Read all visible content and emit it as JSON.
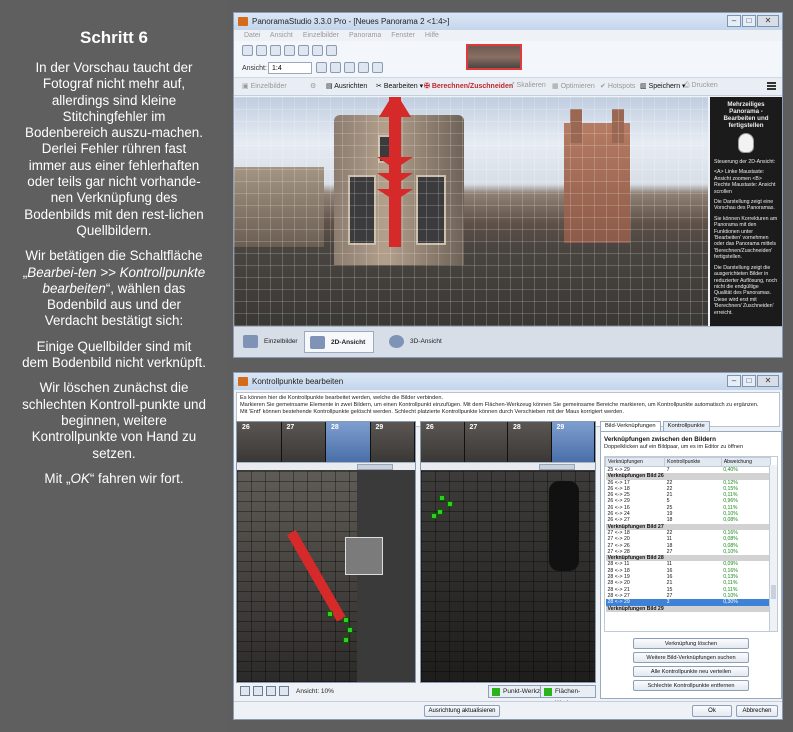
{
  "left": {
    "heading": "Schritt 6",
    "p1": "In der Vorschau taucht der Fotograf nicht mehr auf, allerdings sind kleine Stitchingfehler im Bodenbereich auszu-machen. Derlei Fehler rühren fast immer aus einer fehlerhaften oder teils gar nicht vorhande-nen Verknüpfung des Bodenbilds mit den rest-lichen Quellbildern.",
    "p2_a": "Wir betätigen die Schaltfläche „",
    "p2_em": "Bearbei-ten >> Kontrollpunkte bearbeiten",
    "p2_b": "“, wählen das Bodenbild aus und der Verdacht bestätigt sich:",
    "p3": "Einige Quellbilder sind mit dem Bodenbild nicht verknüpft.",
    "p4": "Wir löschen zunächst die schlechten Kontroll-punkte und beginnen, weitere Kontrollpunkte von Hand zu setzen.",
    "p5_a": "Mit „",
    "p5_em": "OK",
    "p5_b": "“ fahren wir fort."
  },
  "win1": {
    "title": "PanoramaStudio 3.3.0 Pro - [Neues Panorama 2 <1:4>]",
    "menu": [
      "Datei",
      "Ansicht",
      "Einzelbilder",
      "Panorama",
      "Fenster",
      "Hilfe"
    ],
    "ansicht_label": "Ansicht:",
    "ansicht_value": "1:4",
    "toolbar": {
      "einzelbilder": "Einzelbilder",
      "ausrichten": "Ausrichten",
      "bearbeiten": "Bearbeiten",
      "berechnen": "Berechnen/Zuschneiden",
      "skalieren": "Skalieren",
      "optimieren": "Optimieren",
      "hotspots": "Hotspots",
      "speichern": "Speichern",
      "drucken": "Drucken"
    },
    "side": {
      "title": "Mehrzeiliges Panorama - Bearbeiten und fertigstellen",
      "t1": "Steuerung der 2D-Ansicht:",
      "t2": "<A> Linke Maustaste: Ansicht zoomen <B> Rechte Maustaste: Ansicht scrollen",
      "t3": "Die Darstellung zeigt eine Vorschau des Panoramas.",
      "t4": "Sie können Korrekturen am Panorama mit den Funktionen unter 'Bearbeiten' vornehmen oder das Panorama mittels 'Berechnen/Zuschneiden' fertigstellen.",
      "t5": "Die Darstellung zeigt die ausgerichteten Bilder in reduzierter Auflösung, noch nicht die endgültige Qualität des Panoramas. Diese wird erst mit 'Berechnen/ Zuschneiden' erreicht."
    },
    "tabs": {
      "einzelbilder": "Einzelbilder",
      "ansicht2d": "2D-Ansicht",
      "ansicht3d": "3D-Ansicht"
    }
  },
  "win2": {
    "title": "Kontrollpunkte bearbeiten",
    "info1": "Es können hier die Kontrollpunkte bearbeitet werden, welche die Bilder verbinden.",
    "info2": "Markieren Sie gemeinsame Elemente in zwei Bildern, um einen Kontrollpunkt einzufügen. Mit dem Flächen-Werkzeug können Sie gemeinsame Bereiche markieren, um Kontrollpunkte automatisch zu ergänzen.",
    "info3": "Mit 'Entf' können bestehende Kontrollpunkte gelöscht werden. Schlecht platzierte Kontrollpunkte können durch Verschieben mit der Maus korrigiert werden.",
    "left_strip": [
      "26",
      "27",
      "28",
      "29"
    ],
    "right_strip": [
      "26",
      "27",
      "28",
      "29"
    ],
    "zoom_label": "Ansicht: 10%",
    "punkt_werkzeug": "Punkt-Werkzeug",
    "flaechen_werkzeug": "Flächen-Werkzeug",
    "tab_bild": "Bild-Verknüpfungen",
    "tab_kp": "Kontrollpunkte",
    "panel_title": "Verknüpfungen zwischen den Bildern",
    "panel_sub": "Doppelklicken auf ein Bildpaar, um es im Editor zu öffnen",
    "cols": [
      "Verknüpfungen",
      "Kontrollpunkte",
      "Abweichung"
    ],
    "rows": [
      {
        "a": "25 <-> 29",
        "b": "7",
        "c": "0,40%"
      },
      {
        "g": "Verknüpfungen Bild 26"
      },
      {
        "a": "26 <-> 17",
        "b": "22",
        "c": "0,12%"
      },
      {
        "a": "26 <-> 18",
        "b": "22",
        "c": "0,15%"
      },
      {
        "a": "26 <-> 25",
        "b": "21",
        "c": "0,11%"
      },
      {
        "a": "26 <-> 29",
        "b": "5",
        "c": "0,96%"
      },
      {
        "a": "26 <-> 16",
        "b": "25",
        "c": "0,11%"
      },
      {
        "a": "26 <-> 24",
        "b": "19",
        "c": "0,10%"
      },
      {
        "a": "26 <-> 27",
        "b": "18",
        "c": "0,08%"
      },
      {
        "g": "Verknüpfungen Bild 27"
      },
      {
        "a": "27 <-> 18",
        "b": "22",
        "c": "0,16%"
      },
      {
        "a": "27 <-> 20",
        "b": "11",
        "c": "0,08%"
      },
      {
        "a": "27 <-> 26",
        "b": "18",
        "c": "0,08%"
      },
      {
        "a": "27 <-> 28",
        "b": "27",
        "c": "0,10%"
      },
      {
        "g": "Verknüpfungen Bild 28"
      },
      {
        "a": "28 <-> 11",
        "b": "11",
        "c": "0,09%"
      },
      {
        "a": "28 <-> 18",
        "b": "16",
        "c": "0,16%"
      },
      {
        "a": "28 <-> 19",
        "b": "16",
        "c": "0,13%"
      },
      {
        "a": "28 <-> 20",
        "b": "21",
        "c": "0,11%"
      },
      {
        "a": "28 <-> 21",
        "b": "15",
        "c": "0,11%"
      },
      {
        "a": "28 <-> 27",
        "b": "27",
        "c": "0,10%"
      },
      {
        "a": "28 <-> 29",
        "b": "3",
        "c": "0,30%",
        "sel": true
      },
      {
        "g": "Verknüpfungen Bild 29"
      }
    ],
    "btn_loeschen": "Verknüpfung löschen",
    "btn_suchen": "Weitere Bild-Verknüpfungen suchen",
    "btn_verteilen": "Alle Kontrollpunkte neu verteilen",
    "btn_entfernen": "Schlechte Kontrollpunkte entfernen",
    "btn_ausrichtung": "Ausrichtung aktualisieren",
    "btn_ok": "Ok",
    "btn_abbrechen": "Abbrechen"
  }
}
